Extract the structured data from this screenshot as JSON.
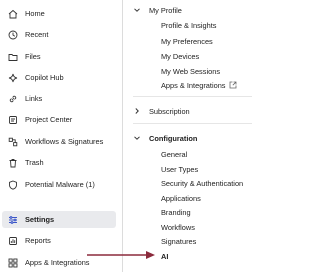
{
  "sidebar": {
    "items": [
      {
        "label": "Home",
        "icon": "home-icon"
      },
      {
        "label": "Recent",
        "icon": "clock-icon"
      },
      {
        "label": "Files",
        "icon": "folder-icon"
      },
      {
        "label": "Copilot Hub",
        "icon": "sparkle-icon"
      },
      {
        "label": "Links",
        "icon": "link-icon"
      },
      {
        "label": "Project Center",
        "icon": "project-icon"
      },
      {
        "label": "Workflows & Signatures",
        "icon": "workflow-icon"
      },
      {
        "label": "Trash",
        "icon": "trash-icon"
      },
      {
        "label": "Potential Malware (1)",
        "icon": "shield-icon"
      },
      {
        "label": "Settings",
        "icon": "settings-sliders-icon",
        "active": true
      },
      {
        "label": "Reports",
        "icon": "reports-icon"
      },
      {
        "label": "Apps & Integrations",
        "icon": "apps-icon"
      }
    ]
  },
  "settings_nav": {
    "my_profile": {
      "label": "My Profile",
      "expanded": true,
      "items": [
        "Profile & Insights",
        "My Preferences",
        "My Devices",
        "My Web Sessions",
        "Apps & Integrations"
      ]
    },
    "subscription": {
      "label": "Subscription",
      "expanded": false
    },
    "configuration": {
      "label": "Configuration",
      "expanded": true,
      "items": [
        "General",
        "User Types",
        "Security & Authentication",
        "Applications",
        "Branding",
        "Workflows",
        "Signatures",
        "AI"
      ],
      "current": "AI"
    }
  },
  "colors": {
    "accent": "#3a55c8",
    "arrow": "#8b2a3c",
    "active_bg": "#e9eaed"
  }
}
